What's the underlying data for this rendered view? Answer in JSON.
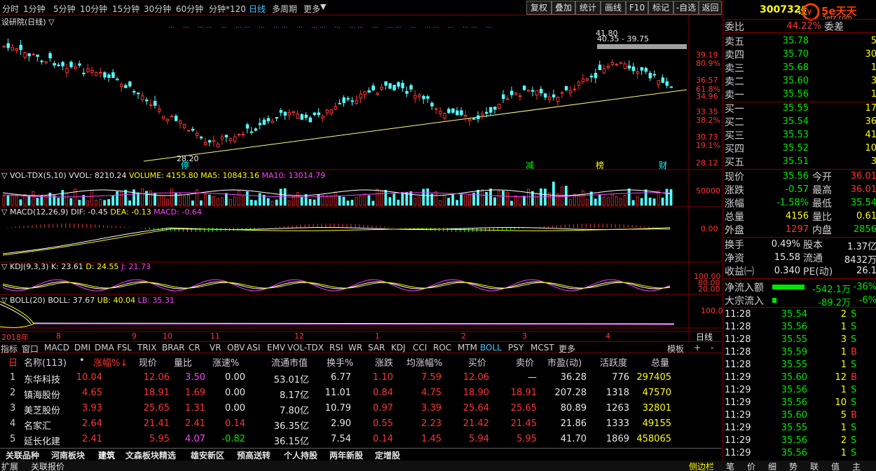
{
  "toolbar": {
    "periods": [
      "分时",
      "1分钟",
      "5分钟",
      "10分钟",
      "15分钟",
      "30分钟",
      "60分钟",
      "分钟*120",
      "日线",
      "多周期",
      "更多"
    ],
    "active_period": "日线",
    "buttons": [
      "复权",
      "叠加",
      "统计",
      "画线",
      "F10",
      "标记",
      "-自选",
      "返回"
    ]
  },
  "main_chart": {
    "title": "设研院(日线)",
    "title_arrow": "▽",
    "axis_labels": [
      "39.19",
      "80.9%",
      "36.57",
      "61.8%",
      "34.96",
      "33.35",
      "38.2%",
      "30.73",
      "19.1%",
      "28.12"
    ],
    "annotations": {
      "high": "41.80",
      "range": "40.35 - 39.75",
      "low": "28.20"
    },
    "markers": [
      "停",
      "减",
      "榜",
      "财"
    ]
  },
  "vol_panel": {
    "name": "VOL-TDX(5,10)",
    "vvol": "VVOL: 8210.24",
    "volume": "VOLUME: 4155.80",
    "ma5": "MA5: 10843.16",
    "ma10": "MA10: 13014.79",
    "axis": "50000"
  },
  "macd_panel": {
    "name": "MACD(12,26,9)",
    "dif": "DIF: -0.45",
    "dea": "DEA: -0.13",
    "macd": "MACD: -0.64",
    "axis": "0.00"
  },
  "kdj_panel": {
    "name": "KDJ(9,3,3)",
    "k": "K: 23.61",
    "d": "D: 24.55",
    "j": "J: 21.73",
    "axis": [
      "100.00",
      "80.00",
      "20.00"
    ]
  },
  "boll_panel": {
    "name": "BOLL(20)",
    "boll": "BOLL: 37.67",
    "ub": "UB: 40.04",
    "lb": "LB: 35.31",
    "axis": "100.0"
  },
  "time_axis": [
    "2018年",
    "8",
    "9",
    "10",
    "11",
    "12",
    "1",
    "2",
    "3",
    "4"
  ],
  "time_axis_right": "日线",
  "indicator_tabs": [
    "指标",
    "窗口",
    "MACD",
    "DMI",
    "DMA",
    "FSL",
    "TRIX",
    "BRAR",
    "CR",
    "VR",
    "OBV",
    "ASI",
    "EMV",
    "VOL-TDX",
    "RSI",
    "WR",
    "SAR",
    "KDJ",
    "CCI",
    "ROC",
    "MTM",
    "BOLL",
    "PSY",
    "MCST",
    "更多"
  ],
  "indicator_tabs_right": [
    "模板",
    "+",
    "-"
  ],
  "table": {
    "headers": [
      "名称(113)",
      "•",
      "涨幅%↓",
      "现价",
      "量比",
      "涨速%",
      "流通市值",
      "换手%",
      "涨跌",
      "均涨幅%",
      "买价",
      "卖价",
      "市盈(动)",
      "活跃度",
      "总量"
    ],
    "rows": [
      {
        "no": "1",
        "name": "东华科技",
        "chg": "10.04",
        "price": "12.06",
        "vr": "3.50",
        "speed": "0.00",
        "mcap": "53.01亿",
        "turnover": "6.77",
        "diff": "1.10",
        "avg": "7.59",
        "bid": "12.06",
        "ask": "—",
        "pe": "36.28",
        "active": "776",
        "vol": "297405"
      },
      {
        "no": "2",
        "name": "镇海股份",
        "chg": "4.65",
        "price": "18.91",
        "vr": "1.69",
        "speed": "0.00",
        "mcap": "8.17亿",
        "turnover": "11.01",
        "diff": "0.84",
        "avg": "4.75",
        "bid": "18.90",
        "ask": "18.91",
        "pe": "207.28",
        "active": "1318",
        "vol": "47570"
      },
      {
        "no": "3",
        "name": "美芝股份",
        "chg": "3.93",
        "price": "25.65",
        "vr": "1.31",
        "speed": "0.00",
        "mcap": "7.80亿",
        "turnover": "10.79",
        "diff": "0.97",
        "avg": "3.39",
        "bid": "25.64",
        "ask": "25.65",
        "pe": "80.89",
        "active": "1263",
        "vol": "32801"
      },
      {
        "no": "4",
        "name": "名家汇",
        "chg": "2.64",
        "price": "21.41",
        "vr": "2.41",
        "speed": "0.14",
        "mcap": "36.35亿",
        "turnover": "2.90",
        "diff": "0.55",
        "avg": "2.23",
        "bid": "21.42",
        "ask": "21.45",
        "pe": "21.86",
        "active": "1333",
        "vol": "49155"
      },
      {
        "no": "5",
        "name": "延长化建",
        "chg": "2.41",
        "price": "5.95",
        "vr": "4.07",
        "speed": "-0.82",
        "mcap": "36.15亿",
        "turnover": "7.54",
        "diff": "0.14",
        "avg": "1.45",
        "bid": "5.94",
        "ask": "5.95",
        "pe": "41.70",
        "active": "1869",
        "vol": "458065"
      }
    ]
  },
  "sheet_tabs": [
    "关联品种",
    "河南板块",
    "建筑",
    "文森板块精选",
    "雄安新区",
    "预高送转",
    "个人持股",
    "两年新股",
    "定增股"
  ],
  "active_sheet": "建筑",
  "status": {
    "left1": "扩展",
    "left2": "关联报价",
    "right": "侧边栏",
    "right_icons": [
      "笔",
      "价",
      "细",
      "势",
      "联",
      "值",
      "主"
    ]
  },
  "quote": {
    "code": "300732",
    "code_suffix": "设",
    "logo": "5e天天",
    "logo_sub": "5etz.com",
    "weibi_label": "委比",
    "weibi": "44.22%",
    "weicha_label": "委差",
    "asks": [
      {
        "label": "卖五",
        "price": "35.78",
        "vol": "5"
      },
      {
        "label": "卖四",
        "price": "35.70",
        "vol": "30"
      },
      {
        "label": "卖三",
        "price": "35.68",
        "vol": "1"
      },
      {
        "label": "卖二",
        "price": "35.60",
        "vol": "3"
      },
      {
        "label": "卖一",
        "price": "35.56",
        "vol": "1"
      }
    ],
    "bids": [
      {
        "label": "买一",
        "price": "35.55",
        "vol": "17"
      },
      {
        "label": "买二",
        "price": "35.54",
        "vol": "36"
      },
      {
        "label": "买三",
        "price": "35.53",
        "vol": "41"
      },
      {
        "label": "买四",
        "price": "35.52",
        "vol": "10"
      },
      {
        "label": "买五",
        "price": "35.51",
        "vol": "3"
      }
    ],
    "stats": [
      {
        "l1": "现价",
        "v1": "35.56",
        "l2": "今开",
        "v2": "36.01",
        "c1": "grn",
        "c2": "red"
      },
      {
        "l1": "涨跌",
        "v1": "-0.57",
        "l2": "最高",
        "v2": "36.01",
        "c1": "grn",
        "c2": "red"
      },
      {
        "l1": "涨幅",
        "v1": "-1.58%",
        "l2": "最低",
        "v2": "35.54",
        "c1": "grn",
        "c2": "grn"
      },
      {
        "l1": "总量",
        "v1": "4156",
        "l2": "量比",
        "v2": "0.61",
        "c1": "yel",
        "c2": "yel"
      },
      {
        "l1": "外盘",
        "v1": "1297",
        "l2": "内盘",
        "v2": "2856",
        "c1": "red",
        "c2": "grn"
      }
    ],
    "stats2": [
      {
        "l1": "换手",
        "v1": "0.49%",
        "l2": "股本",
        "v2": "1.37亿"
      },
      {
        "l1": "净资",
        "v1": "15.58",
        "l2": "流通",
        "v2": "8432万"
      },
      {
        "l1": "收益㈠",
        "v1": "0.340",
        "l2": "PE(动)",
        "v2": "26.1"
      }
    ],
    "flows": [
      {
        "label": "净流入额",
        "value": "-542.1万",
        "pct": "-36%"
      },
      {
        "label": "大宗流入",
        "value": "-89.2万",
        "pct": "-6%"
      }
    ],
    "ticks": [
      {
        "t": "11:28",
        "p": "35.54",
        "v": "2",
        "s": "S"
      },
      {
        "t": "11:28",
        "p": "35.56",
        "v": "1",
        "s": "S"
      },
      {
        "t": "11:28",
        "p": "35.55",
        "v": "3",
        "s": "S"
      },
      {
        "t": "11:28",
        "p": "35.59",
        "v": "1",
        "s": "B"
      },
      {
        "t": "11:28",
        "p": "35.55",
        "v": "1",
        "s": "S"
      },
      {
        "t": "11:29",
        "p": "35.60",
        "v": "12",
        "s": "B"
      },
      {
        "t": "11:29",
        "p": "35.56",
        "v": "1",
        "s": "S"
      },
      {
        "t": "11:29",
        "p": "35.56",
        "v": "10",
        "s": "S"
      },
      {
        "t": "11:29",
        "p": "35.60",
        "v": "5",
        "s": "B"
      },
      {
        "t": "11:29",
        "p": "35.55",
        "v": "1",
        "s": "S"
      },
      {
        "t": "11:29",
        "p": "35.56",
        "v": "2",
        "s": "S"
      },
      {
        "t": "11:29",
        "p": "35.56",
        "v": "1",
        "s": "S"
      }
    ]
  }
}
